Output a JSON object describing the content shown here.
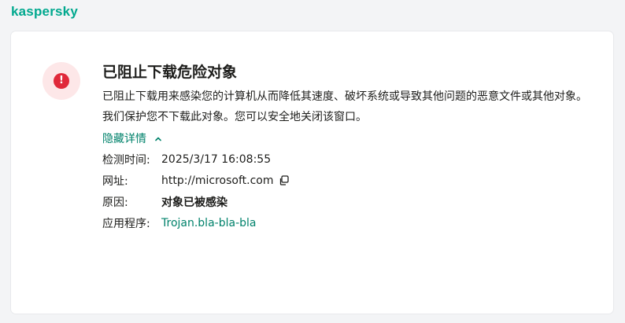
{
  "brand": {
    "logo": "kaspersky",
    "color": "#00a88e"
  },
  "alert": {
    "icon": "exclamation-icon",
    "title": "已阻止下载危险对象",
    "description": "已阻止下载用来感染您的计算机从而降低其速度、破坏系统或导致其他问题的恶意文件或其他对象。",
    "note": "我们保护您不下载此对象。您可以安全地关闭该窗口。",
    "toggle_label": "隐藏详情",
    "details": {
      "time_label": "检测时间:",
      "time_value": "2025/3/17 16:08:55",
      "url_label": "网址:",
      "url_value": "http://microsoft.com",
      "reason_label": "原因:",
      "reason_value": "对象已被感染",
      "app_label": "应用程序:",
      "app_value": "Trojan.bla-bla-bla"
    }
  },
  "colors": {
    "accent": "#00826b",
    "danger": "#e0293a",
    "danger_bg": "#fde7e8"
  }
}
